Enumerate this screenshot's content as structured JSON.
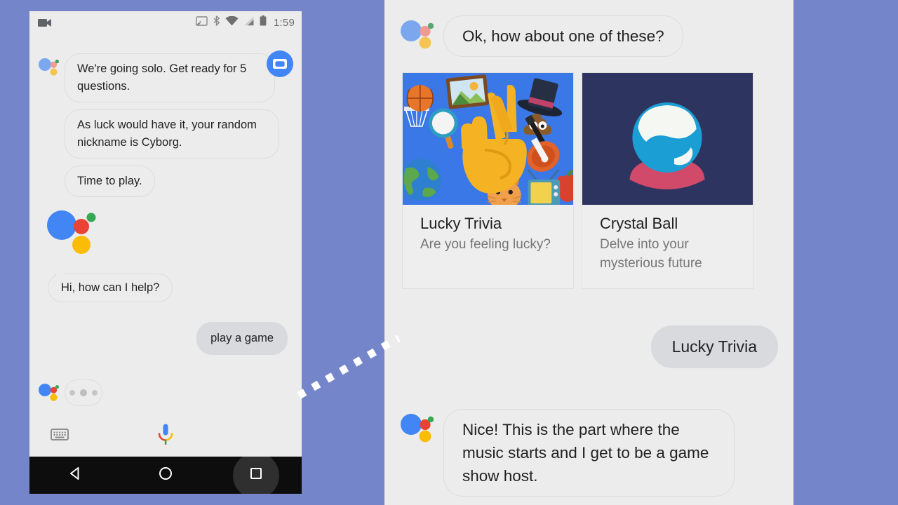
{
  "background_color": "#7486c9",
  "phone": {
    "status_bar": {
      "time": "1:59",
      "icons": [
        "video-camera-icon",
        "cast-icon",
        "bluetooth-icon",
        "wifi-icon",
        "cellular-signal-icon",
        "battery-icon"
      ]
    },
    "avatar_badge": "game-show-host-avatar",
    "messages": [
      {
        "sender": "assistant",
        "text": "We're going solo. Get ready for 5 questions.",
        "show_logo": true
      },
      {
        "sender": "assistant",
        "text": "As luck would have it, your random nickname is Cyborg.",
        "show_logo": false
      },
      {
        "sender": "assistant",
        "text": "Time to play.",
        "show_logo": false
      },
      {
        "sender": "assistant",
        "text": "Hi, how can I help?",
        "show_logo": false
      },
      {
        "sender": "user",
        "text": "play a game"
      },
      {
        "sender": "assistant",
        "text": "",
        "typing": true
      }
    ],
    "input_bar": {
      "keyboard_label": "keyboard-icon",
      "mic_label": "microphone-icon"
    },
    "nav_bar": {
      "back_label": "back-button",
      "home_label": "home-button",
      "recents_label": "recents-button"
    }
  },
  "right_panel": {
    "messages": [
      {
        "sender": "assistant",
        "text": "Ok, how about one of these?"
      },
      {
        "sender": "user",
        "text": "Lucky Trivia"
      },
      {
        "sender": "assistant",
        "text": "Nice! This is the part where the music starts and I get to be a game show host."
      }
    ],
    "cards": [
      {
        "title": "Lucky Trivia",
        "subtitle": "Are you feeling lucky?",
        "image_name": "lucky-trivia-crossed-fingers-image",
        "image_bg": "#3b78e7",
        "accent": "#f5b324"
      },
      {
        "title": "Crystal Ball",
        "subtitle": "Delve into your mysterious future",
        "image_name": "crystal-ball-image",
        "image_bg": "#2e3460",
        "accent": "#1a9ed4"
      }
    ]
  },
  "colors": {
    "google_blue": "#4285f4",
    "google_red": "#ea4335",
    "google_yellow": "#fbbc05",
    "google_green": "#34a853",
    "panel_bg": "#ececec",
    "user_bubble": "#d8dade"
  }
}
